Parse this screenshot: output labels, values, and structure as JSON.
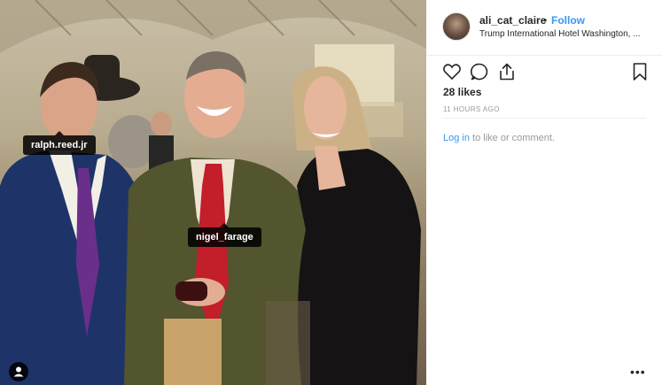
{
  "post": {
    "tags": [
      {
        "label": "ralph.reed.jr"
      },
      {
        "label": "nigel_farage"
      }
    ]
  },
  "header": {
    "username": "ali_cat_claire",
    "separator": "•",
    "follow_label": "Follow",
    "location": "Trump International Hotel Washington, ..."
  },
  "actions": {
    "icons": [
      "heart-icon",
      "comment-icon",
      "share-icon",
      "bookmark-icon"
    ]
  },
  "stats": {
    "likes": "28 likes",
    "time": "11 HOURS AGO"
  },
  "comment": {
    "login_link": "Log in",
    "suffix": " to like or comment."
  },
  "more_label": "•••",
  "colors": {
    "follow": "#3897f0",
    "text": "#262626",
    "muted": "#999999"
  }
}
